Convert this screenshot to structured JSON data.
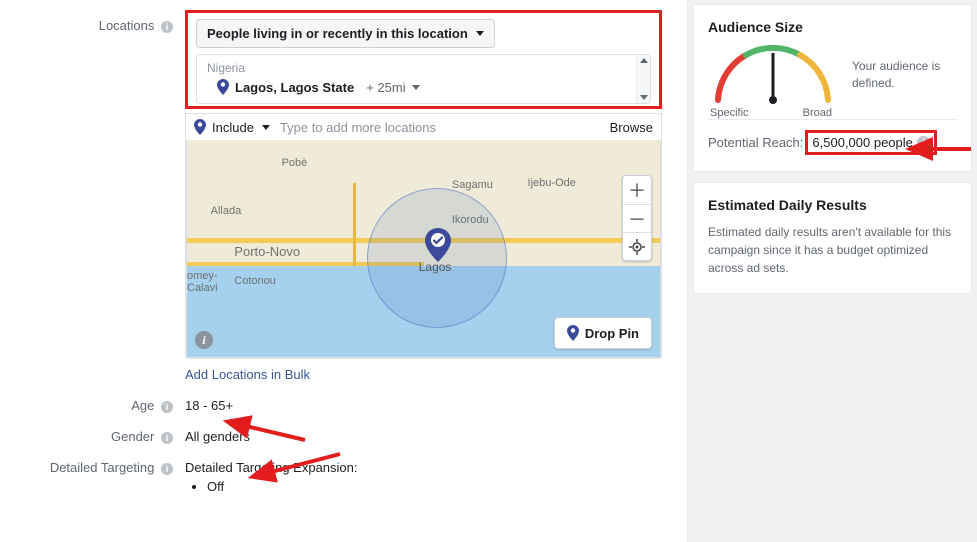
{
  "locations": {
    "label": "Locations",
    "dropdown_label": "People living in or recently in this location",
    "country": "Nigeria",
    "place": "Lagos, Lagos State",
    "radius": "+ 25mi",
    "include_label": "Include",
    "input_placeholder": "Type to add more locations",
    "browse_label": "Browse",
    "bulk_link": "Add Locations in Bulk",
    "drop_pin_label": "Drop Pin",
    "map_labels": {
      "pobe": "Pobè",
      "allada": "Allada",
      "sagamu": "Sagamu",
      "ijebu": "Ijebu-Ode",
      "ikorodu": "Ikorodu",
      "porto": "Porto-Novo",
      "cotonou": "Cotonou",
      "comey": "omey-\nCalavi",
      "lagos": "Lagos"
    }
  },
  "age": {
    "label": "Age",
    "value": "18 - 65+"
  },
  "gender": {
    "label": "Gender",
    "value": "All genders"
  },
  "detailed": {
    "label": "Detailed Targeting",
    "expansion_label": "Detailed Targeting Expansion:",
    "status": "Off"
  },
  "audience": {
    "title": "Audience Size",
    "defined_text": "Your audience is defined.",
    "specific": "Specific",
    "broad": "Broad",
    "reach_label": "Potential Reach:",
    "reach_value": "6,500,000 people"
  },
  "daily": {
    "title": "Estimated Daily Results",
    "body": "Estimated daily results aren't available for this campaign since it has a budget optimized across ad sets."
  }
}
